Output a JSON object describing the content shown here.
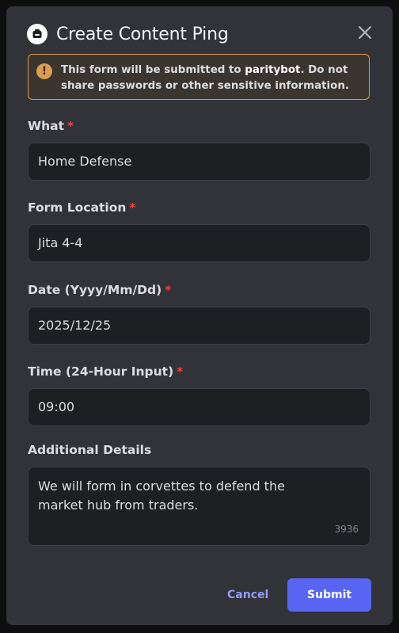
{
  "dialog": {
    "title": "Create Content Ping",
    "close_icon": "close-icon",
    "app_icon": "bot-icon"
  },
  "warning": {
    "icon": "warning-icon",
    "glyph": "!",
    "text_before": "This form will be submitted to ",
    "bot_name": "paritybot",
    "text_after": ". Do not share passwords or other sensitive information."
  },
  "fields": {
    "what": {
      "label": "What",
      "required_mark": "*",
      "value": "Home Defense"
    },
    "form_location": {
      "label": "Form Location",
      "required_mark": "*",
      "value": "Jita 4-4"
    },
    "date": {
      "label": "Date (Yyyy/Mm/Dd)",
      "required_mark": "*",
      "value": "2025/12/25"
    },
    "time": {
      "label": "Time (24-Hour Input)",
      "required_mark": "*",
      "value": "09:00"
    },
    "details": {
      "label": "Additional Details",
      "value": "We will form in corvettes to defend the market hub from traders.",
      "remaining_chars": "3936"
    }
  },
  "footer": {
    "cancel_label": "Cancel",
    "submit_label": "Submit"
  },
  "colors": {
    "modal_bg": "#313338",
    "input_bg": "#1e1f22",
    "accent": "#5865f2",
    "link": "#949cf7",
    "required": "#f23f43",
    "warning_border": "#d79a4f"
  }
}
